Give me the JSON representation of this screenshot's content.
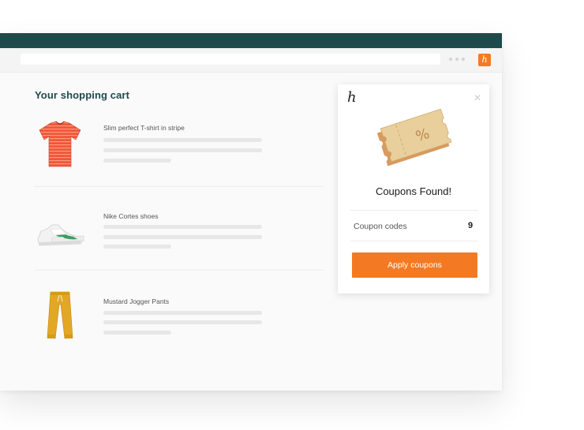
{
  "browser": {
    "extension_icon": "honey-h-icon"
  },
  "cart": {
    "title": "Your shopping cart",
    "items": [
      {
        "name": "Slim perfect T-shirt in stripe",
        "image": "striped-tshirt-icon"
      },
      {
        "name": "Nike Cortes shoes",
        "image": "sneaker-icon"
      },
      {
        "name": "Mustard Jogger Pants",
        "image": "jogger-pants-icon"
      }
    ]
  },
  "popup": {
    "logo": "h",
    "close_icon": "close-icon",
    "heading": "Coupons Found!",
    "codes_label": "Coupon codes",
    "codes_count": "9",
    "apply_label": "Apply coupons",
    "accent_color": "#f37a23"
  },
  "colors": {
    "titlebar": "#1f4a4c",
    "accent": "#f37a23"
  }
}
